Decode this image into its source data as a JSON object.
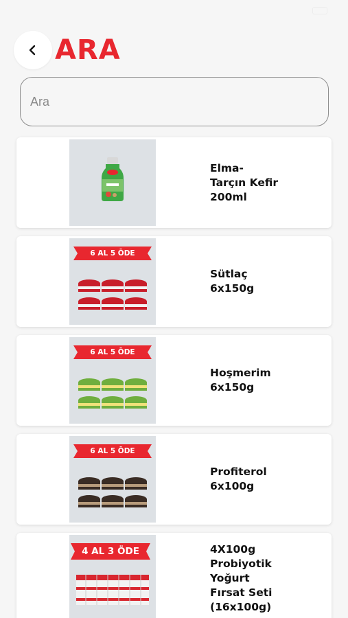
{
  "status_bar": {
    "time": "",
    "carrier": ""
  },
  "header": {
    "title": "ARA",
    "back_icon": "chevron-left-icon"
  },
  "search": {
    "placeholder": "Ara",
    "value": ""
  },
  "products": [
    {
      "name": "Elma-\nTarçın Kefir\n200ml",
      "image": "kefir-bottle",
      "badge": ""
    },
    {
      "name": "Sütlaç\n6x150g",
      "image": "dessert-cups-red",
      "badge": "6 AL 5 ÖDE"
    },
    {
      "name": "Hoşmerim\n6x150g",
      "image": "dessert-cups-green",
      "badge": "6 AL 5 ÖDE"
    },
    {
      "name": "Profiterol\n6x100g",
      "image": "dessert-cups-brown",
      "badge": "6 AL 5 ÖDE"
    },
    {
      "name": "4X100g\nProbiyotik\nYoğurt\nFırsat Seti\n(16x100g)",
      "image": "yogurt-multipack",
      "badge": "4 AL 3 ÖDE"
    }
  ],
  "colors": {
    "accent": "#e8272f",
    "background": "#f6f6f6",
    "card": "#ffffff"
  }
}
